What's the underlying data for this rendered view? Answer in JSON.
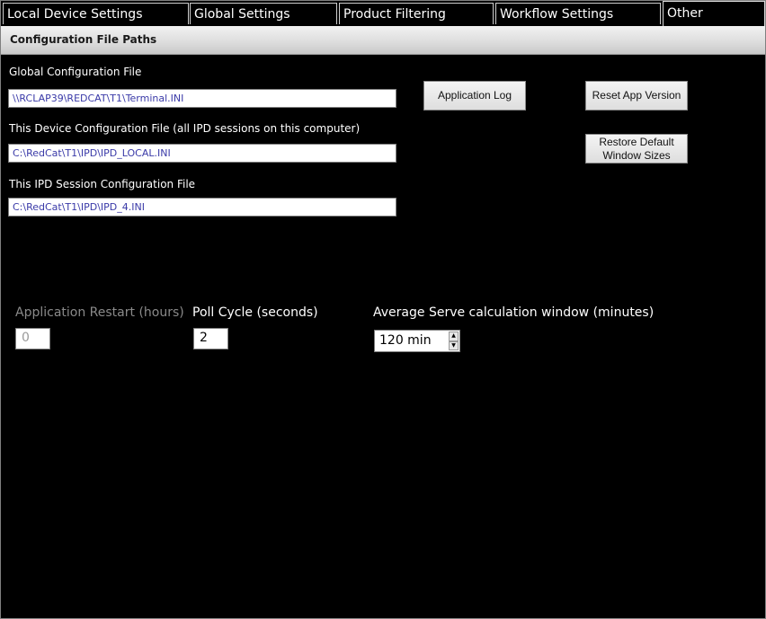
{
  "tabs": [
    {
      "label": "Local Device Settings"
    },
    {
      "label": "Global Settings"
    },
    {
      "label": "Product Filtering"
    },
    {
      "label": "Workflow Settings"
    },
    {
      "label": "Other"
    }
  ],
  "section": {
    "title": "Configuration File Paths"
  },
  "paths": {
    "global_label": "Global Configuration File",
    "global_value": "\\\\RCLAP39\\REDCAT\\T1\\Terminal.INI",
    "device_label": "This Device Configuration File (all IPD sessions on this computer)",
    "device_value": "C:\\RedCat\\T1\\IPD\\IPD_LOCAL.INI",
    "session_label": "This IPD Session Configuration File",
    "session_value": "C:\\RedCat\\T1\\IPD\\IPD_4.INI"
  },
  "buttons": {
    "application_log": "Application Log",
    "reset_app_version": "Reset App Version",
    "restore_line1": "Restore Default",
    "restore_line2": "Window Sizes"
  },
  "settings": {
    "restart_label": "Application Restart  (hours)",
    "restart_value": "0",
    "poll_label": "Poll Cycle (seconds)",
    "poll_value": "2",
    "avg_label": "Average Serve calculation window (minutes)",
    "avg_value": "120 min"
  },
  "icons": {
    "spin_up": "▲",
    "spin_down": "▼"
  }
}
